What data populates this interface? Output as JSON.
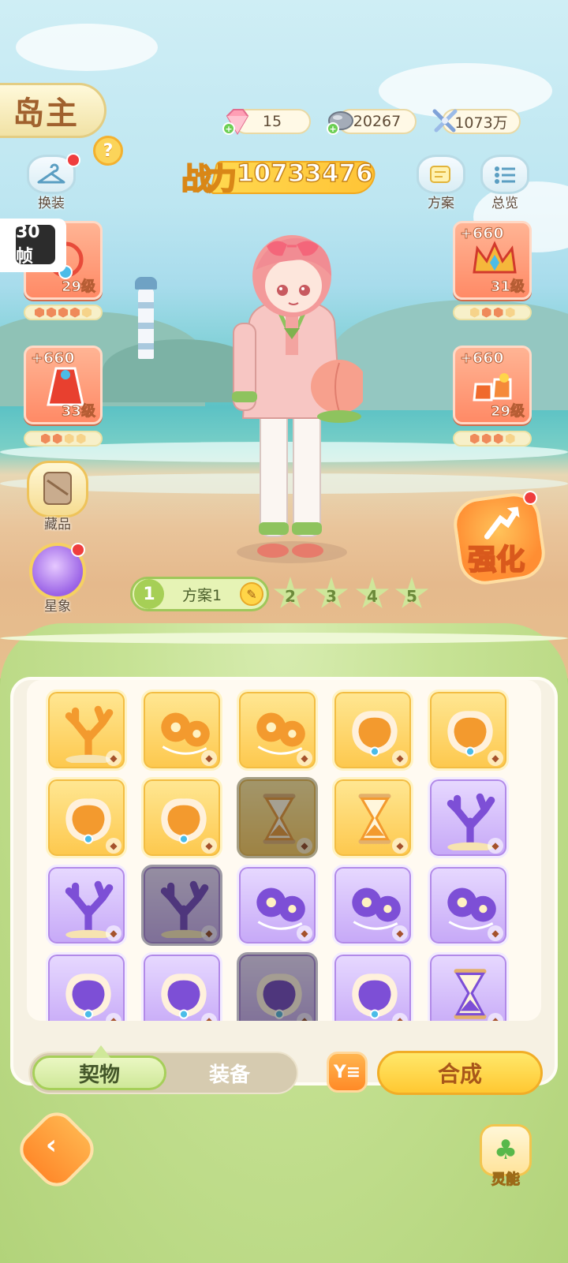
{
  "header": {
    "title": "岛主",
    "help": "?"
  },
  "currencies": [
    {
      "icon": "pink-diamond-icon",
      "value": "15"
    },
    {
      "icon": "silver-ore-icon",
      "value": "20267"
    },
    {
      "icon": "crossed-swords-icon",
      "value": "1073万"
    }
  ],
  "power": {
    "label": "战力",
    "value": "10733476"
  },
  "left_buttons": {
    "dress": "换装"
  },
  "right_buttons": {
    "plans": "方案",
    "overview": "总览"
  },
  "fps_badge": "30帧",
  "slots": [
    {
      "name": "slot-left-top",
      "plus": "",
      "level": "29级",
      "gems_on": 4,
      "gems_total": 5
    },
    {
      "name": "slot-left-bottom",
      "plus": "+660",
      "level": "33级",
      "gems_on": 2,
      "gems_total": 4
    },
    {
      "name": "slot-right-top",
      "plus": "+660",
      "level": "31级",
      "gems_on": 3,
      "gems_total": 4
    },
    {
      "name": "slot-right-bottom",
      "plus": "+660",
      "level": "29级",
      "gems_on": 3,
      "gems_total": 4
    }
  ],
  "round_buttons": {
    "collection": "藏品",
    "astrology": "星象"
  },
  "enhance": "强化",
  "plan_selector": {
    "current_num": "1",
    "current_name": "方案1",
    "others": [
      "2",
      "3",
      "4",
      "5"
    ]
  },
  "inventory": {
    "rows": [
      [
        {
          "rarity": "gold",
          "kind": "coral",
          "dim": false
        },
        {
          "rarity": "gold",
          "kind": "flower",
          "dim": false
        },
        {
          "rarity": "gold",
          "kind": "flower",
          "dim": false
        },
        {
          "rarity": "gold",
          "kind": "shell",
          "dim": false
        },
        {
          "rarity": "gold",
          "kind": "shell",
          "dim": false
        }
      ],
      [
        {
          "rarity": "gold",
          "kind": "shell",
          "dim": false
        },
        {
          "rarity": "gold",
          "kind": "shell",
          "dim": false
        },
        {
          "rarity": "gold",
          "kind": "hourglass",
          "dim": true
        },
        {
          "rarity": "gold",
          "kind": "hourglass",
          "dim": false
        },
        {
          "rarity": "purple",
          "kind": "coral",
          "dim": false
        }
      ],
      [
        {
          "rarity": "purple",
          "kind": "coral",
          "dim": false
        },
        {
          "rarity": "purple",
          "kind": "coral",
          "dim": true
        },
        {
          "rarity": "purple",
          "kind": "flower",
          "dim": false
        },
        {
          "rarity": "purple",
          "kind": "flower",
          "dim": false
        },
        {
          "rarity": "purple",
          "kind": "flower",
          "dim": false
        }
      ],
      [
        {
          "rarity": "purple",
          "kind": "shell",
          "dim": false
        },
        {
          "rarity": "purple",
          "kind": "shell",
          "dim": false
        },
        {
          "rarity": "purple",
          "kind": "shell",
          "dim": true
        },
        {
          "rarity": "purple",
          "kind": "shell",
          "dim": false
        },
        {
          "rarity": "purple",
          "kind": "hourglass",
          "dim": false
        }
      ]
    ]
  },
  "bottom_tabs": {
    "active": "契物",
    "inactive": "装备"
  },
  "filter_label": "Y≡",
  "compose": "合成",
  "spirit": "灵能",
  "colors": {
    "gold_card": "#fdc84d",
    "purple_card": "#c6a8f7",
    "accent_green": "#a6cf56",
    "accent_orange": "#ff8a27"
  }
}
